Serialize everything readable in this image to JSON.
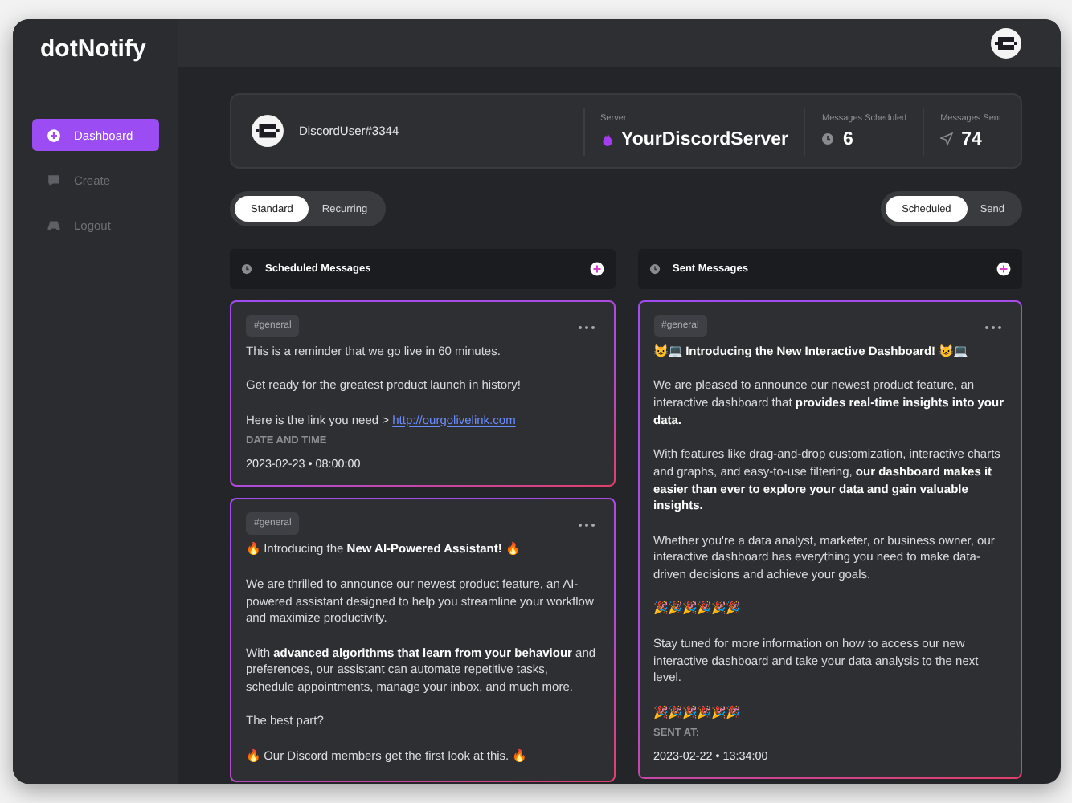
{
  "logo": "dotNotify",
  "sidebar": {
    "items": [
      {
        "label": "Dashboard",
        "selected": true
      },
      {
        "label": "Create",
        "selected": false
      },
      {
        "label": "Logout",
        "selected": false
      }
    ]
  },
  "profile": {
    "username": "DiscordUser#3344",
    "stats": [
      {
        "label": "Server",
        "value": "YourDiscordServer"
      },
      {
        "label": "Messages Scheduled",
        "value": "6"
      },
      {
        "label": "Messages Sent",
        "value": "74"
      }
    ]
  },
  "mode_tabs": [
    {
      "label": "Standard",
      "selected": true
    },
    {
      "label": "Recurring",
      "selected": false
    }
  ],
  "view_tabs": [
    {
      "label": "Scheduled",
      "selected": true
    },
    {
      "label": "Send",
      "selected": false
    }
  ],
  "columns": [
    {
      "title": "Scheduled Messages",
      "messages": [
        {
          "channel": "#general",
          "paragraphs": [
            {
              "text": "This is a reminder that we go live in 60 minutes."
            },
            {
              "text": "Get ready for the greatest product launch in history!"
            },
            {
              "text": "Here is the link you need > ",
              "link": "http://ourgolivelink.com"
            }
          ],
          "meta_label": "DATE AND TIME",
          "meta_value": "2023-02-23 • 08:00:00"
        },
        {
          "channel": "#general",
          "paragraphs": [
            {
              "text": "🔥 Introducing the **New AI-Powered Assistant!** 🔥"
            },
            {
              "text": "We are thrilled to announce our newest product feature, an AI-powered assistant designed to help you streamline your workflow and maximize productivity."
            },
            {
              "text": "With **advanced algorithms that learn from your behaviour** and preferences, our assistant can automate repetitive tasks, schedule appointments, manage your inbox, and much more."
            },
            {
              "text": "The best part?"
            },
            {
              "text": "🔥 Our Discord members get the first look at this. 🔥"
            }
          ]
        }
      ]
    },
    {
      "title": "Sent Messages",
      "messages": [
        {
          "channel": "#general",
          "paragraphs": [
            {
              "text": "**😺💻 Introducing the New Interactive Dashboard! 😺💻**"
            },
            {
              "text": "We are pleased to announce our newest product feature, an interactive dashboard that **provides real-time insights into your data.**"
            },
            {
              "text": "With features like drag-and-drop customization, interactive charts and graphs, and easy-to-use filtering, **our dashboard makes it easier than ever to explore your data and gain valuable insights.**"
            },
            {
              "text": "Whether you're a data analyst, marketer, or business owner, our interactive dashboard has everything you need to make data-driven decisions and achieve your goals."
            },
            {
              "text": "🎉🎉🎉🎉🎉🎉"
            },
            {
              "text": "Stay tuned for more information on how to access our new interactive dashboard and take your data analysis to the next level."
            },
            {
              "text": "🎉🎉🎉🎉🎉🎉"
            }
          ],
          "meta_label": "SENT AT:",
          "meta_value": "2023-02-22 • 13:34:00"
        }
      ]
    }
  ]
}
